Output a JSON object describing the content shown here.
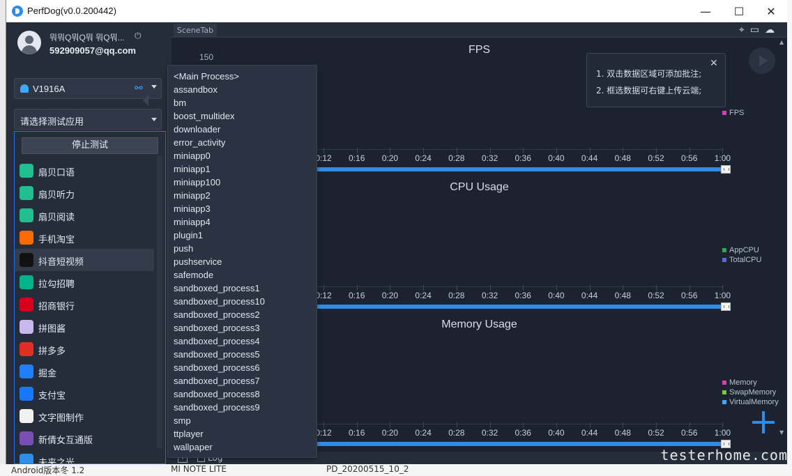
{
  "window": {
    "title": "PerfDog(v0.0.200442)"
  },
  "window_controls": {
    "minimize": "—",
    "maximize": "☐",
    "close": "✕"
  },
  "user": {
    "name": "뭐뭐Q뭐Q뭐 뭐Q뭐...",
    "email": "592909057@qq.com"
  },
  "device": {
    "name": "V1916A"
  },
  "app_select": {
    "placeholder": "请选择测试应用"
  },
  "stop_button": "停止测试",
  "apps": [
    {
      "label": "扇贝口语",
      "icon": "shanbei-speak-icon",
      "color": "#1fbf8f"
    },
    {
      "label": "扇贝听力",
      "icon": "shanbei-listen-icon",
      "color": "#1fbf8f"
    },
    {
      "label": "扇贝阅读",
      "icon": "shanbei-read-icon",
      "color": "#1fbf8f"
    },
    {
      "label": "手机淘宝",
      "icon": "taobao-icon",
      "color": "#ff6a00"
    },
    {
      "label": "抖音短视频",
      "icon": "douyin-icon",
      "color": "#111111"
    },
    {
      "label": "拉勾招聘",
      "icon": "lagou-icon",
      "color": "#00b38a"
    },
    {
      "label": "招商银行",
      "icon": "cmb-icon",
      "color": "#d9001b"
    },
    {
      "label": "拼图酱",
      "icon": "pintujiang-icon",
      "color": "#c9b8f0"
    },
    {
      "label": "拼多多",
      "icon": "pinduoduo-icon",
      "color": "#e02e24"
    },
    {
      "label": "掘金",
      "icon": "juejin-icon",
      "color": "#1e80ff"
    },
    {
      "label": "支付宝",
      "icon": "alipay-icon",
      "color": "#1677ff"
    },
    {
      "label": "文字图制作",
      "icon": "text-image-icon",
      "color": "#f1f1f1"
    },
    {
      "label": "新倩女互通版",
      "icon": "qiannv-icon",
      "color": "#7a4fb5"
    },
    {
      "label": "未来之光",
      "icon": "weilai-icon",
      "color": "#2d8de8"
    }
  ],
  "scene_tab": "SceneTab",
  "tip": {
    "line1": "1. 双击数据区域可添加批注;",
    "line2": "2. 框选数据可右键上传云端;"
  },
  "charts": [
    {
      "title": "FPS",
      "ytick": "150",
      "legend": [
        {
          "name": "FPS",
          "color": "#d63fb0"
        }
      ]
    },
    {
      "title": "CPU Usage",
      "legend": [
        {
          "name": "AppCPU",
          "color": "#2fa84f"
        },
        {
          "name": "TotalCPU",
          "color": "#5a6bd8"
        }
      ]
    },
    {
      "title": "Memory Usage",
      "legend": [
        {
          "name": "Memory",
          "color": "#d63fb0"
        },
        {
          "name": "SwapMemory",
          "color": "#7fc43a"
        },
        {
          "name": "VirtualMemory",
          "color": "#3ea8ff"
        }
      ]
    }
  ],
  "time_ticks": [
    "0:12",
    "0:16",
    "0:20",
    "0:24",
    "0:28",
    "0:32",
    "0:36",
    "0:40",
    "0:44",
    "0:48",
    "0:52",
    "0:56",
    "1:00"
  ],
  "processes": [
    "<Main Process>",
    "assandbox",
    "bm",
    "boost_multidex",
    "downloader",
    "error_activity",
    "miniapp0",
    "miniapp1",
    "miniapp100",
    "miniapp2",
    "miniapp3",
    "miniapp4",
    "plugin1",
    "push",
    "pushservice",
    "safemode",
    "sandboxed_process1",
    "sandboxed_process10",
    "sandboxed_process2",
    "sandboxed_process3",
    "sandboxed_process4",
    "sandboxed_process5",
    "sandboxed_process6",
    "sandboxed_process7",
    "sandboxed_process8",
    "sandboxed_process9",
    "smp",
    "ttplayer",
    "wallpaper"
  ],
  "bottom": {
    "log_label": "Log"
  },
  "background": {
    "text1": "Android版本冬 1.2",
    "text2": "MI NOTE LITE",
    "text3": "PD_20200515_10_2"
  },
  "watermark": "testerhome.com"
}
